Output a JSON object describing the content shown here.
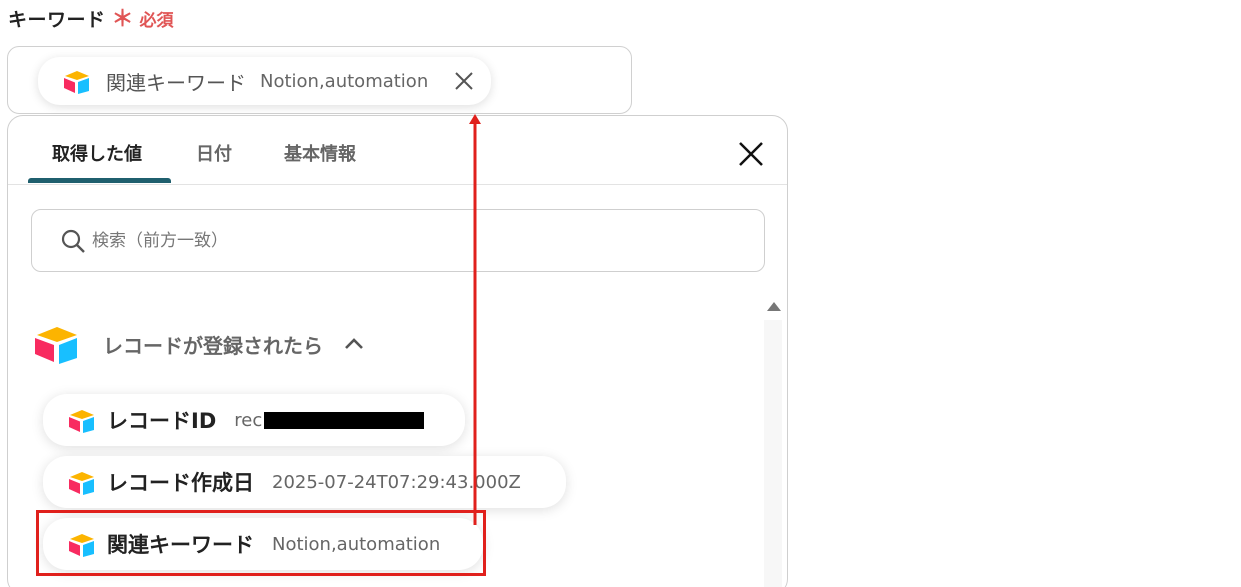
{
  "field": {
    "label": "キーワード",
    "required_mark": "＊",
    "required_text": "必須"
  },
  "selected_chip": {
    "name": "関連キーワード",
    "value": "Notion,automation",
    "icon": "airtable-logo-icon"
  },
  "panel": {
    "tabs": [
      {
        "label": "取得した値",
        "active": true
      },
      {
        "label": "日付",
        "active": false
      },
      {
        "label": "基本情報",
        "active": false
      }
    ],
    "search_placeholder": "検索（前方一致）",
    "group": {
      "title": "レコードが登録されたら",
      "icon": "airtable-logo-icon",
      "expanded": true
    },
    "items": [
      {
        "name": "レコードID",
        "value": "rec",
        "redacted": true
      },
      {
        "name": "レコード作成日",
        "value": "2025-07-24T07:29:43.000Z"
      },
      {
        "name": "関連キーワード",
        "value": "Notion,automation",
        "highlighted": true
      }
    ]
  },
  "colors": {
    "accent": "#1f5f6e",
    "required": "#e05555",
    "annotation": "#e0201c"
  }
}
